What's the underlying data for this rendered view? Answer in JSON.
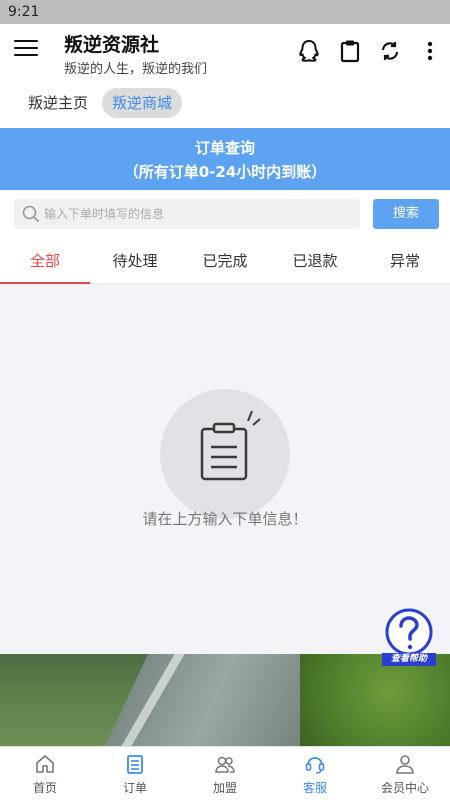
{
  "status_bar": {
    "time": "9:21"
  },
  "header": {
    "title": "叛逆资源社",
    "subtitle": "叛逆的人生，叛逆的我们",
    "icons": [
      "menu-icon",
      "qq-icon",
      "clipboard-icon",
      "refresh-icon",
      "more-icon"
    ]
  },
  "top_tabs": [
    {
      "label": "叛逆主页",
      "active": false
    },
    {
      "label": "叛逆商城",
      "active": true
    }
  ],
  "banner": {
    "line1": "订单查询",
    "line2": "（所有订单0-24小时内到账）",
    "color": "#5ea3f1"
  },
  "search": {
    "placeholder": "输入下单时填写的信息",
    "value": "",
    "button_label": "搜索"
  },
  "status_tabs": [
    {
      "label": "全部",
      "active": true
    },
    {
      "label": "待处理",
      "active": false
    },
    {
      "label": "已完成",
      "active": false
    },
    {
      "label": "已退款",
      "active": false
    },
    {
      "label": "异常",
      "active": false
    }
  ],
  "empty_state": {
    "message": "请在上方输入下单信息！",
    "icon": "clipboard-icon"
  },
  "help_badge": {
    "label": "查看帮助",
    "icon": "question-icon"
  },
  "bottom_nav": [
    {
      "label": "首页",
      "icon": "home-icon",
      "active": false
    },
    {
      "label": "订单",
      "icon": "order-icon",
      "active": false
    },
    {
      "label": "加盟",
      "icon": "team-icon",
      "active": false
    },
    {
      "label": "客服",
      "icon": "headset-icon",
      "active": true
    },
    {
      "label": "会员中心",
      "icon": "user-icon",
      "active": false
    }
  ],
  "colors": {
    "accent": "#3d8ce8",
    "active_tab": "#e84848"
  }
}
